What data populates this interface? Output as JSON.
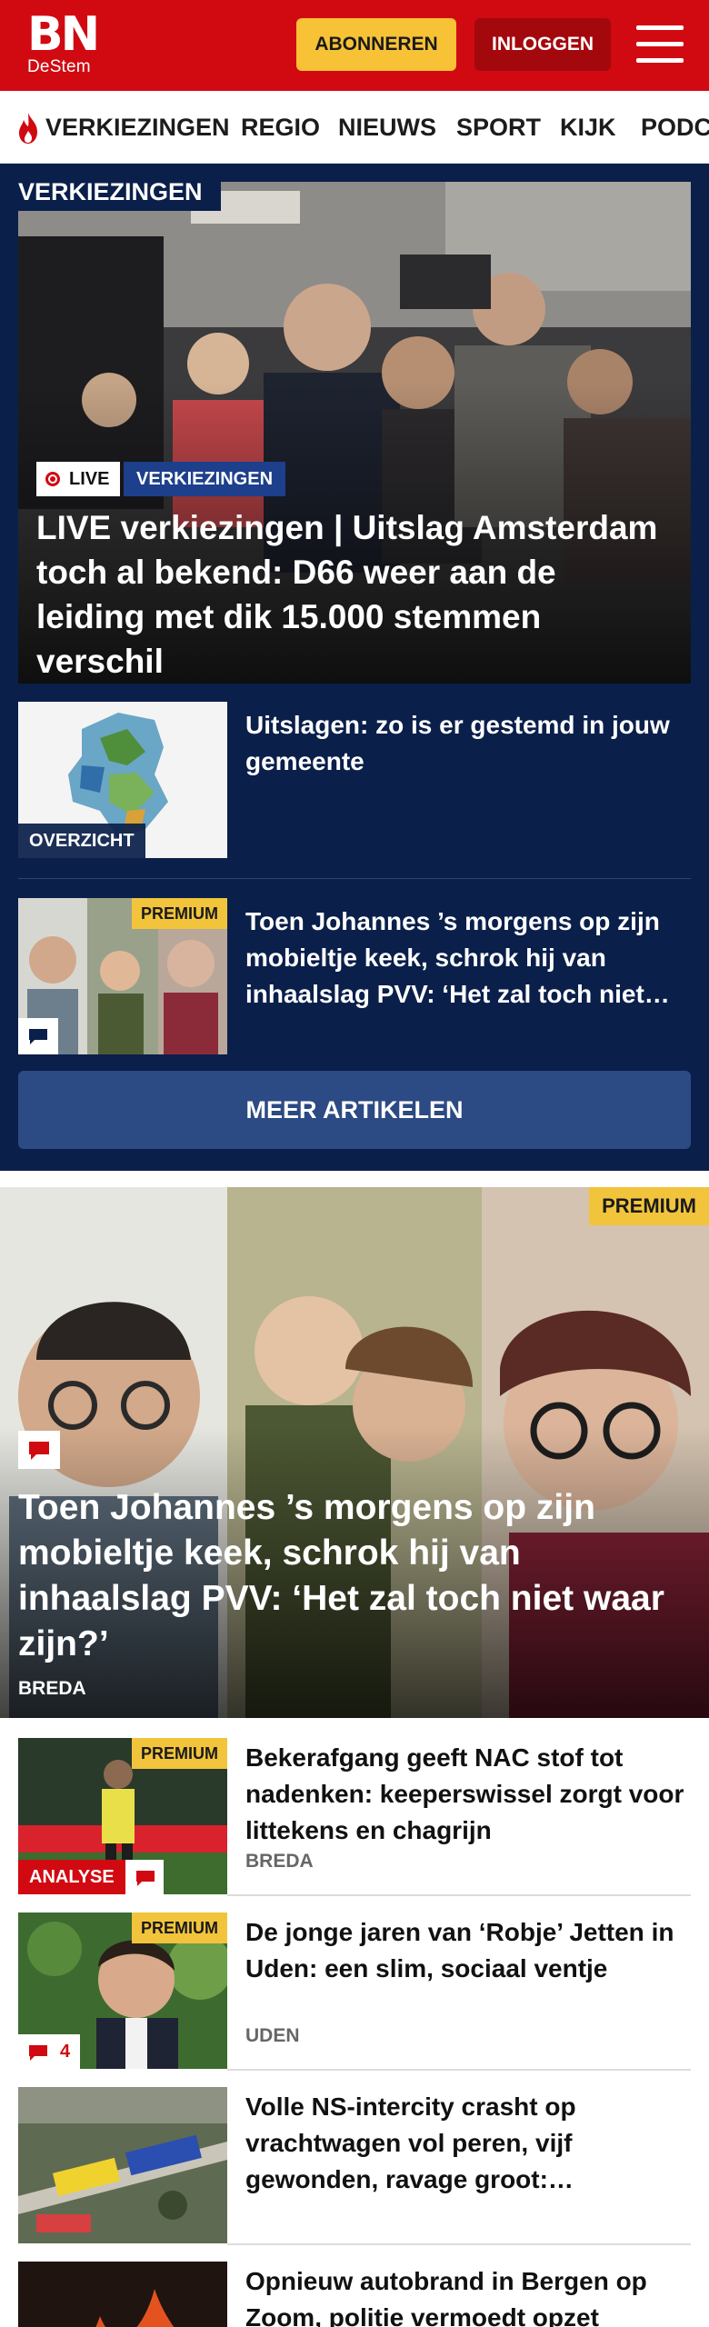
{
  "header": {
    "logo_main": "BN",
    "logo_sub": "DeStem",
    "subscribe_label": "ABONNEREN",
    "login_label": "INLOGGEN"
  },
  "nav": {
    "items": [
      "VERKIEZINGEN",
      "REGIO",
      "NIEUWS",
      "SPORT",
      "KIJK",
      "PODCASTS"
    ]
  },
  "section": {
    "label": "VERKIEZINGEN",
    "hero": {
      "live_label": "LIVE",
      "category": "VERKIEZINGEN",
      "title": "LIVE verkiezingen | Uitslag Amsterdam toch al bekend: D66 weer aan de leiding met dik 15.000 stemmen verschil"
    },
    "articles": [
      {
        "title": "Uitslagen: zo is er gestemd in jouw gemeente",
        "label": "OVERZICHT"
      },
      {
        "title": "Toen Johannes ’s morgens op zijn mobieltje keek, schrok hij van inhaalslag PVV: ‘Het zal toch niet…",
        "premium": "PREMIUM"
      }
    ],
    "more_label": "MEER ARTIKELEN"
  },
  "feature": {
    "premium": "PREMIUM",
    "title": "Toen Johannes ’s morgens op zijn mobieltje keek, schrok hij van inhaalslag PVV: ‘Het zal toch niet waar zijn?’",
    "location": "BREDA"
  },
  "list": [
    {
      "title": "Bekerafgang geeft NAC stof tot nadenken: keeperswissel zorgt voor littekens en chagrijn",
      "location": "BREDA",
      "premium": "PREMIUM",
      "tag": "ANALYSE"
    },
    {
      "title": "De jonge jaren van ‘Robje’ Jetten in Uden: een slim, sociaal ventje",
      "location": "UDEN",
      "premium": "PREMIUM",
      "comments": "4"
    },
    {
      "title": "Volle NS-intercity crasht op vrachtwagen vol peren, vijf gewonden, ravage groot:…"
    },
    {
      "title": "Opnieuw autobrand in Bergen op Zoom, politie vermoedt opzet"
    }
  ],
  "colors": {
    "brand_red": "#d10a11",
    "navy": "#0a1f4a",
    "premium_yellow": "#f2c43c",
    "subscribe_yellow": "#f7c236"
  }
}
